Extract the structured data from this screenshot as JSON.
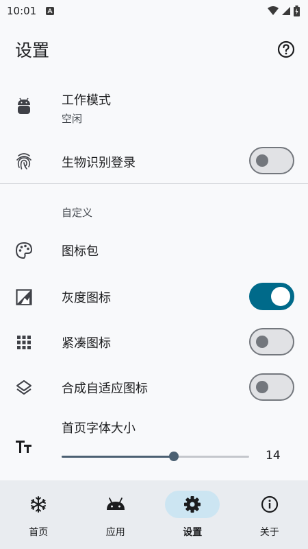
{
  "status_bar": {
    "time": "10:01"
  },
  "app_bar": {
    "title": "设置"
  },
  "settings": {
    "work_mode": {
      "label": "工作模式",
      "value": "空闲"
    },
    "biometric_login": {
      "label": "生物识别登录",
      "enabled": false
    },
    "custom_section": {
      "header": "自定义"
    },
    "icon_pack": {
      "label": "图标包"
    },
    "grayscale_icons": {
      "label": "灰度图标",
      "enabled": true
    },
    "compact_icons": {
      "label": "紧凑图标",
      "enabled": false
    },
    "adaptive_icons": {
      "label": "合成自适应图标",
      "enabled": false
    },
    "home_font_size": {
      "label": "首页字体大小",
      "value": "14",
      "fraction": 0.6
    }
  },
  "nav": {
    "items": [
      {
        "label": "首页",
        "icon": "snowflake-icon",
        "active": false
      },
      {
        "label": "应用",
        "icon": "android-icon",
        "active": false
      },
      {
        "label": "设置",
        "icon": "gear-icon",
        "active": true
      },
      {
        "label": "关于",
        "icon": "info-icon",
        "active": false
      }
    ]
  },
  "colors": {
    "accent": "#006a8a",
    "background": "#f8f9fb",
    "nav_background": "#e9ecf0",
    "nav_active_pill": "#cce5f2"
  }
}
